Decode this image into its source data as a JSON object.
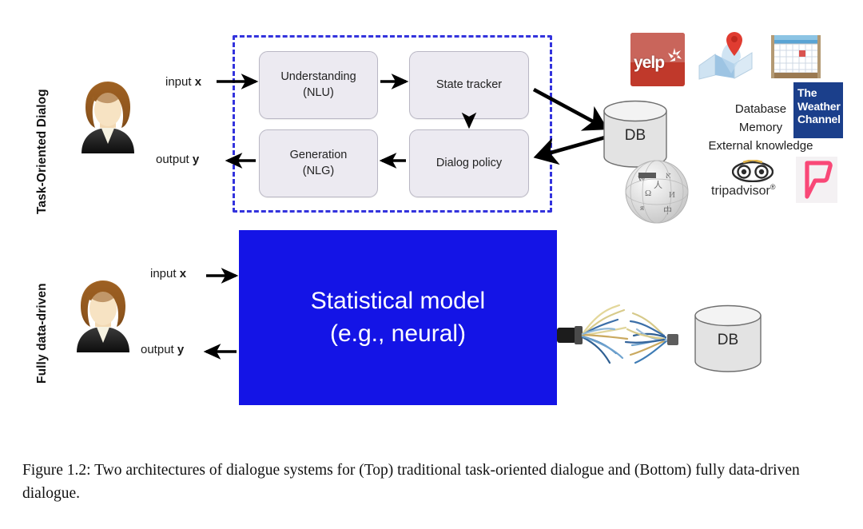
{
  "figure": {
    "rows": [
      {
        "id": "top",
        "label": "Task-Oriented Dialog"
      },
      {
        "id": "bottom",
        "label": "Fully data-driven"
      }
    ],
    "io": {
      "input_prefix": "input ",
      "input_symbol": "x",
      "output_prefix": "output ",
      "output_symbol": "y"
    },
    "pipeline": {
      "modules": [
        {
          "name": "understanding",
          "line1": "Understanding",
          "line2": "(NLU)"
        },
        {
          "name": "state-tracker",
          "line1": "State tracker",
          "line2": ""
        },
        {
          "name": "generation",
          "line1": "Generation",
          "line2": "(NLG)"
        },
        {
          "name": "dialog-policy",
          "line1": "Dialog policy",
          "line2": ""
        }
      ],
      "frame_color": "#3333dd",
      "module_fill": "#eceaf1"
    },
    "statistical_model": {
      "line1": "Statistical model",
      "line2": "(e.g., neural)",
      "fill": "#1414e6",
      "text_color": "#ffffff"
    },
    "databases": [
      {
        "name": "db-top",
        "label": "DB"
      },
      {
        "name": "db-bottom",
        "label": "DB"
      }
    ],
    "knowledge_sources": {
      "lines": [
        "Database",
        "Memory",
        "External knowledge"
      ],
      "logos": [
        {
          "name": "yelp-logo",
          "text": "yelp",
          "color": "#c0392b"
        },
        {
          "name": "maps-logo",
          "text": "",
          "color": "#d93025"
        },
        {
          "name": "calendar-logo",
          "text": "",
          "color": "#4a90c4"
        },
        {
          "name": "weather-channel-logo",
          "line1": "The",
          "line2": "Weather",
          "line3": "Channel",
          "color": "#1b3f8b"
        },
        {
          "name": "wikipedia-logo",
          "text": "",
          "color": "#999999"
        },
        {
          "name": "tripadvisor-logo",
          "text": "tripadvisor",
          "registered": "®",
          "color": "#2b2b2b"
        },
        {
          "name": "foursquare-logo",
          "text": "",
          "color": "#f94877"
        }
      ]
    }
  },
  "caption": {
    "text": "Figure 1.2: Two architectures of dialogue systems for (Top) traditional task-oriented dialogue and (Bottom) fully data-driven dialogue."
  }
}
